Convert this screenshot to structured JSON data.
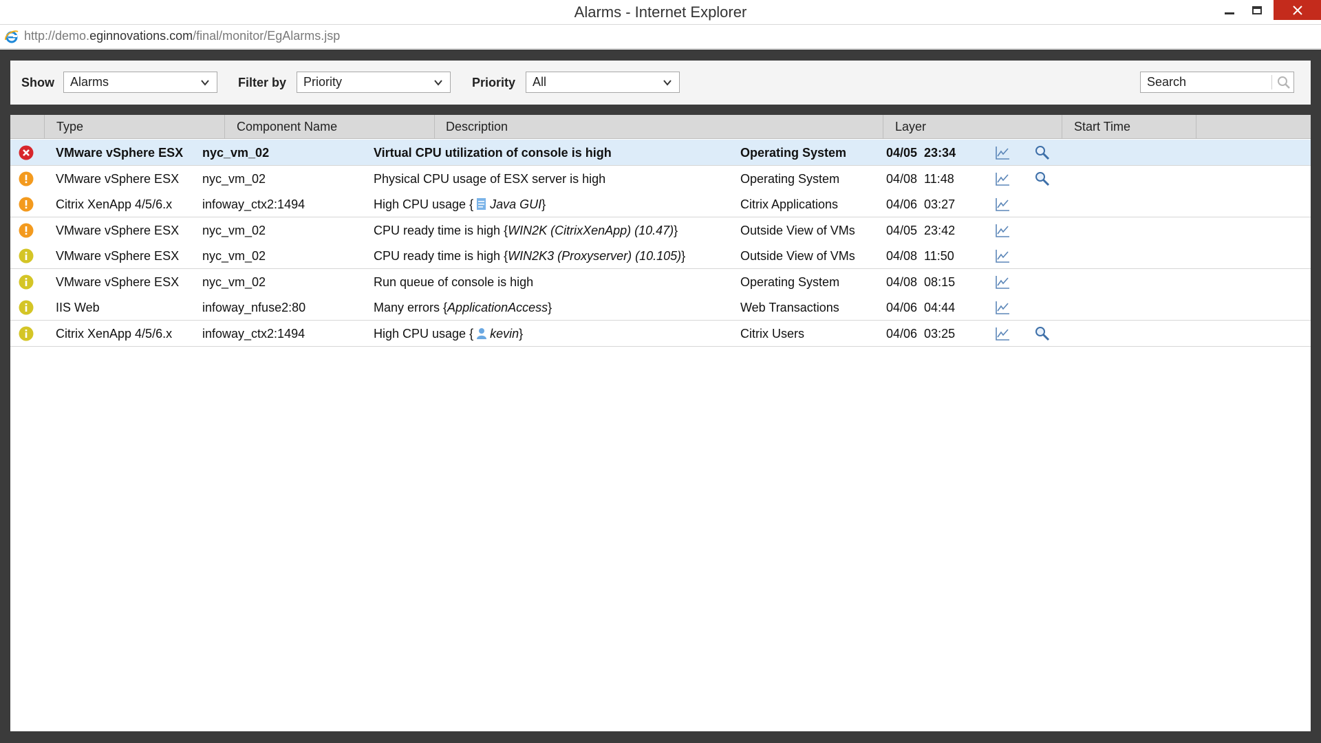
{
  "window": {
    "title": "Alarms - Internet Explorer",
    "url_prefix": "http://demo.",
    "url_host": "eginnovations.com",
    "url_path": "/final/monitor/EgAlarms.jsp"
  },
  "toolbar": {
    "show_label": "Show",
    "show_value": "Alarms",
    "filter_label": "Filter by",
    "filter_value": "Priority",
    "priority_label": "Priority",
    "priority_value": "All",
    "search_placeholder": "Search"
  },
  "colors": {
    "critical": "#d7262b",
    "major": "#f39a1e",
    "minor": "#d4c526",
    "selected_row": "#ddecf9",
    "header_bg": "#d9d9d9",
    "frame_bg": "#3b3b3b"
  },
  "table": {
    "columns": [
      "Type",
      "Component Name",
      "Description",
      "Layer",
      "Start Time"
    ],
    "rows": [
      {
        "severity": "critical",
        "type": "VMware vSphere ESX",
        "component": "nyc_vm_02",
        "description": "Virtual CPU utilization of console is high",
        "layer": "Operating System",
        "start_time": "04/05  23:34",
        "has_graph": true,
        "has_zoom": true
      },
      {
        "severity": "major",
        "type": "VMware vSphere ESX",
        "component": "nyc_vm_02",
        "description": "Physical CPU usage of ESX server is high",
        "layer": "Operating System",
        "start_time": "04/08  11:48",
        "has_graph": true,
        "has_zoom": true
      },
      {
        "severity": "major",
        "type": "Citrix XenApp 4/5/6.x",
        "component": "infoway_ctx2:1494",
        "description": "High CPU usage {",
        "description_icon": "document-icon",
        "description_detail": "Java GUI",
        "description_suffix": "}",
        "layer": "Citrix Applications",
        "start_time": "04/06  03:27",
        "has_graph": true,
        "has_zoom": false
      },
      {
        "severity": "major",
        "type": "VMware vSphere ESX",
        "component": "nyc_vm_02",
        "description": "CPU ready time is high {",
        "description_detail": "WIN2K (CitrixXenApp) (10.47)",
        "description_suffix": "}",
        "layer": "Outside View of VMs",
        "start_time": "04/05  23:42",
        "has_graph": true,
        "has_zoom": false
      },
      {
        "severity": "minor",
        "type": "VMware vSphere ESX",
        "component": "nyc_vm_02",
        "description": "CPU ready time is high {",
        "description_detail": "WIN2K3 (Proxyserver) (10.105)",
        "description_suffix": "}",
        "layer": "Outside View of VMs",
        "start_time": "04/08  11:50",
        "has_graph": true,
        "has_zoom": false
      },
      {
        "severity": "minor",
        "type": "VMware vSphere ESX",
        "component": "nyc_vm_02",
        "description": "Run queue of console is high",
        "layer": "Operating System",
        "start_time": "04/08  08:15",
        "has_graph": true,
        "has_zoom": false
      },
      {
        "severity": "minor",
        "type": "IIS Web",
        "component": "infoway_nfuse2:80",
        "description": "Many errors {",
        "description_detail": "ApplicationAccess",
        "description_suffix": "}",
        "layer": "Web Transactions",
        "start_time": "04/06  04:44",
        "has_graph": true,
        "has_zoom": false
      },
      {
        "severity": "minor",
        "type": "Citrix XenApp 4/5/6.x",
        "component": "infoway_ctx2:1494",
        "description": "High CPU usage {",
        "description_icon": "user-icon",
        "description_detail": "kevin",
        "description_suffix": "}",
        "layer": "Citrix Users",
        "start_time": "04/06  03:25",
        "has_graph": true,
        "has_zoom": true
      }
    ]
  }
}
